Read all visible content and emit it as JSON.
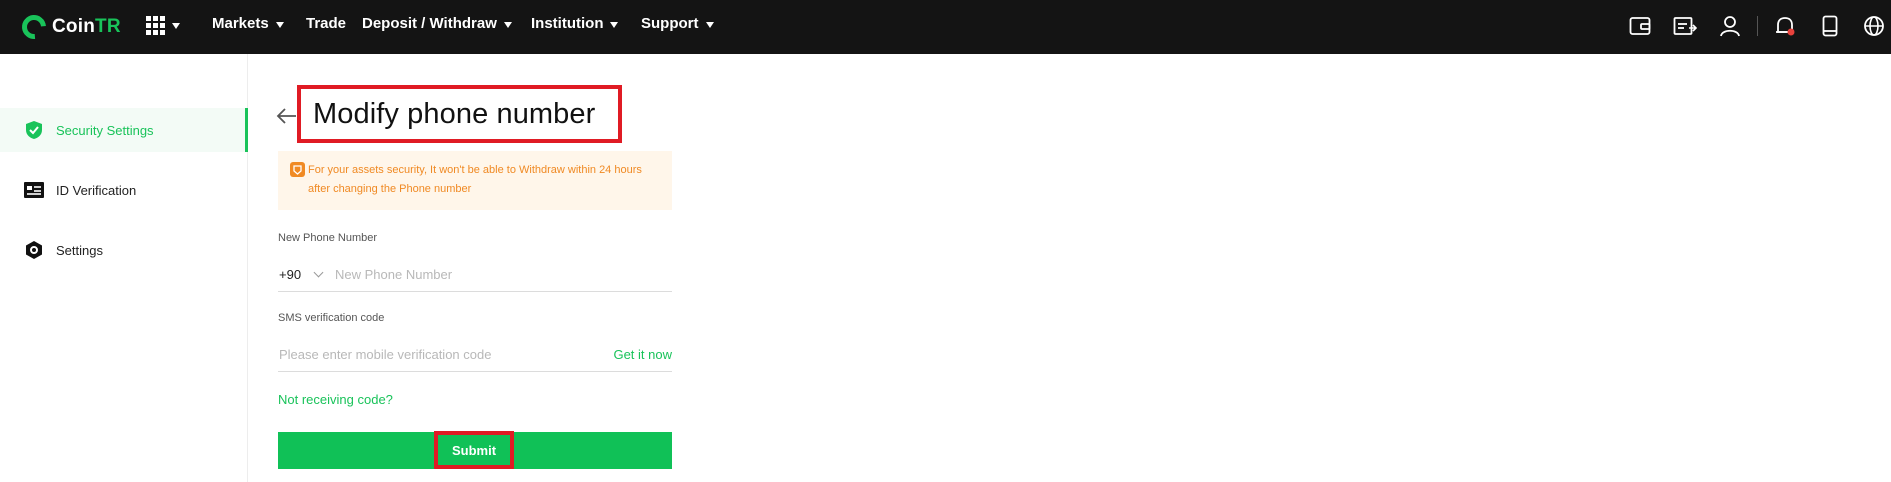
{
  "brand": {
    "name_main": "Coin",
    "name_accent": "TR"
  },
  "nav": {
    "items": [
      {
        "label": "Markets",
        "has_caret": true
      },
      {
        "label": "Trade",
        "has_caret": false
      },
      {
        "label": "Deposit / Withdraw",
        "has_caret": true
      },
      {
        "label": "Institution",
        "has_caret": true
      },
      {
        "label": "Support",
        "has_caret": true
      }
    ],
    "right_icons": [
      "wallet-icon",
      "orders-icon",
      "user-icon",
      "bell-icon",
      "mobile-icon",
      "globe-icon"
    ]
  },
  "sidebar": {
    "items": [
      {
        "label": "Security Settings",
        "icon": "shield-check-icon",
        "active": true
      },
      {
        "label": "ID Verification",
        "icon": "id-card-icon",
        "active": false
      },
      {
        "label": "Settings",
        "icon": "settings-hex-icon",
        "active": false
      }
    ]
  },
  "page": {
    "title": "Modify phone number",
    "notice": "For your assets security, It won't be able to Withdraw within 24 hours after changing the Phone number"
  },
  "form": {
    "phone_label": "New Phone Number",
    "country_code": "+90",
    "phone_placeholder": "New Phone Number",
    "sms_label": "SMS verification code",
    "sms_placeholder": "Please enter mobile verification code",
    "get_code_label": "Get it now",
    "not_receiving_label": "Not receiving code?",
    "submit_label": "Submit"
  },
  "colors": {
    "accent": "#19c35a",
    "highlight": "#e01b24",
    "warning": "#f08a24",
    "nav_bg": "#141414"
  }
}
